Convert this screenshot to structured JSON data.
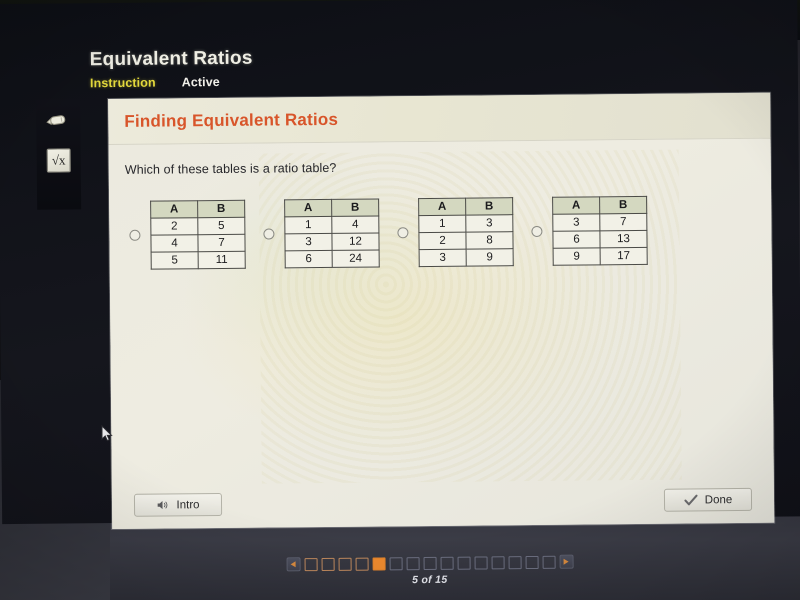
{
  "header": {
    "lesson_title": "Equivalent Ratios",
    "tabs": [
      {
        "label": "Instruction",
        "state": "active"
      },
      {
        "label": "Active",
        "state": "inactive"
      }
    ]
  },
  "tool_rail": {
    "items": [
      {
        "icon": "pencil-icon",
        "label": "Highlighter"
      },
      {
        "icon": "calculator-icon",
        "label": "√x"
      }
    ]
  },
  "slide": {
    "title": "Finding Equivalent Ratios",
    "title_color": "#d8552a",
    "question": "Which of these tables is a ratio table?"
  },
  "options": [
    {
      "selected": false,
      "headers": [
        "A",
        "B"
      ],
      "rows": [
        [
          "2",
          "5"
        ],
        [
          "4",
          "7"
        ],
        [
          "5",
          "11"
        ]
      ]
    },
    {
      "selected": false,
      "headers": [
        "A",
        "B"
      ],
      "rows": [
        [
          "1",
          "4"
        ],
        [
          "3",
          "12"
        ],
        [
          "6",
          "24"
        ]
      ]
    },
    {
      "selected": false,
      "headers": [
        "A",
        "B"
      ],
      "rows": [
        [
          "1",
          "3"
        ],
        [
          "2",
          "8"
        ],
        [
          "3",
          "9"
        ]
      ]
    },
    {
      "selected": false,
      "headers": [
        "A",
        "B"
      ],
      "rows": [
        [
          "3",
          "7"
        ],
        [
          "6",
          "13"
        ],
        [
          "9",
          "17"
        ]
      ]
    }
  ],
  "footer": {
    "intro_label": "Intro",
    "done_label": "Done"
  },
  "pager": {
    "label": "5 of 15",
    "current": 5,
    "total": 15,
    "prev_icon": "triangle-left-icon",
    "next_icon": "triangle-right-icon",
    "current_color": "#ee8a2e"
  }
}
